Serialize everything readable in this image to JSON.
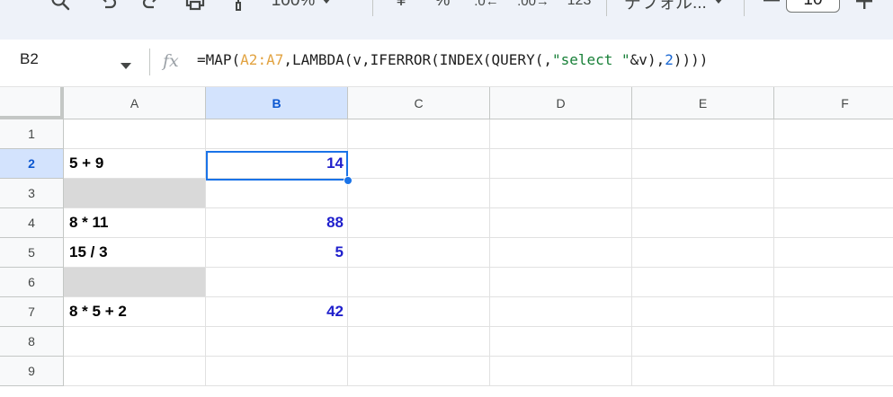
{
  "toolbar": {
    "zoom": "100%",
    "percent_label": "%",
    "format_123": "123",
    "font_name": "デフォル...",
    "font_size": "10"
  },
  "formula_bar": {
    "cell_ref": "B2",
    "fx_label": "fx",
    "formula_parts": [
      "=MAP(",
      "A2:A7",
      ",LAMBDA(v,IFERROR(INDEX(QUERY(,",
      "\"select \"",
      "&v),",
      "2",
      "))))"
    ]
  },
  "columns": [
    "A",
    "B",
    "C",
    "D",
    "E",
    "F"
  ],
  "selected_column": "B",
  "rows": [
    "1",
    "2",
    "3",
    "4",
    "5",
    "6",
    "7",
    "8",
    "9"
  ],
  "selected_row": "2",
  "cells": {
    "A2": "5 + 9",
    "A4": "8 * 11",
    "A5": "15 / 3",
    "A7": "8 * 5 + 2",
    "B2": "14",
    "B4": "88",
    "B5": "5",
    "B7": "42"
  },
  "shaded_cells": [
    "A3",
    "A6"
  ],
  "colors": {
    "selection": "#1a73e8",
    "header_selected": "#d3e3fd",
    "result_text": "#1f1fcc",
    "shaded_fill": "#d9d9d9",
    "range_ref": "#e2a341",
    "string_literal": "#188038",
    "number_literal": "#1967d2"
  }
}
